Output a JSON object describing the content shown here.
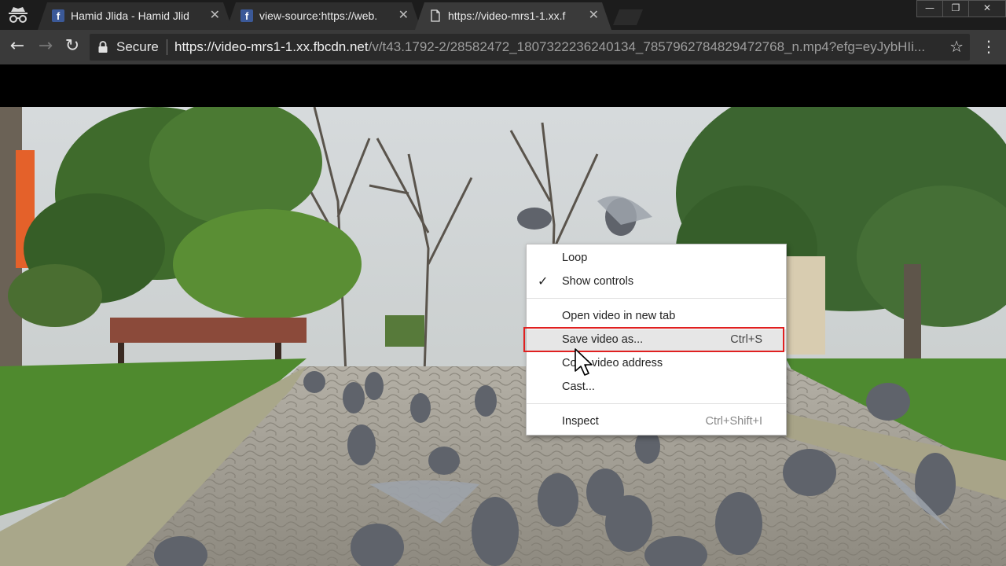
{
  "browser": {
    "tabs": [
      {
        "title": "Hamid Jlida - Hamid Jlid",
        "favicon": "facebook-icon"
      },
      {
        "title": "view-source:https://web.",
        "favicon": "facebook-icon"
      },
      {
        "title": "https://video-mrs1-1.xx.f",
        "favicon": "document-icon",
        "active": true
      }
    ],
    "security_label": "Secure",
    "url_host": "https://video-mrs1-1.xx.fbcdn.net",
    "url_path": "/v/t43.1792-2/28582472_1807322236240134_7857962784829472768_n.mp4?efg=eyJybHIi..."
  },
  "context_menu": {
    "items": [
      {
        "label": "Loop",
        "shortcut": ""
      },
      {
        "label": "Show controls",
        "shortcut": "",
        "checked": true
      },
      {
        "label": "Open video in new tab",
        "shortcut": ""
      },
      {
        "label": "Save video as...",
        "shortcut": "Ctrl+S",
        "highlighted": true
      },
      {
        "label": "Copy video address",
        "shortcut": ""
      },
      {
        "label": "Cast...",
        "shortcut": ""
      },
      {
        "label": "Inspect",
        "shortcut": "Ctrl+Shift+I"
      }
    ]
  },
  "colors": {
    "tabstrip": "#1c1c1c",
    "toolbar": "#3a3a3a",
    "highlight_ring": "#e02020",
    "facebook": "#3b5998"
  }
}
